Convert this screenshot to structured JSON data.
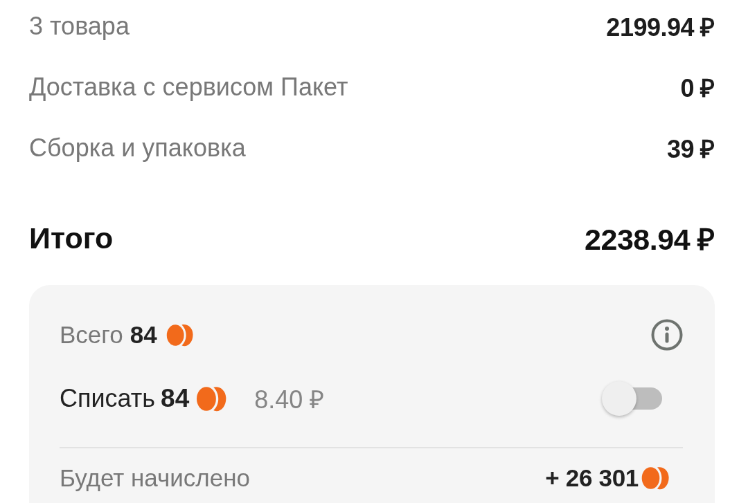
{
  "summary_rows": [
    {
      "label": "3 товара",
      "value": "2199.94 ₽"
    },
    {
      "label": "Доставка с сервисом Пакет",
      "value": "0 ₽"
    },
    {
      "label": "Сборка и упаковка",
      "value": "39 ₽"
    }
  ],
  "total": {
    "label": "Итого",
    "value": "2238.94 ₽"
  },
  "bonus_card": {
    "balance": {
      "label": "Всего",
      "amount": "84"
    },
    "spend": {
      "label": "Списать",
      "amount": "84",
      "rubles": "8.40 ₽",
      "on": false
    },
    "accrual": {
      "label": "Будет начислено",
      "amount": "+ 26 301"
    }
  }
}
